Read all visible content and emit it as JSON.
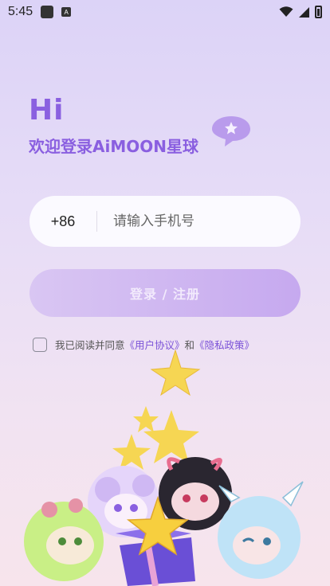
{
  "status_bar": {
    "time": "5:45",
    "a_badge": "A"
  },
  "header": {
    "greeting": "Hi",
    "welcome": "欢迎登录AiMOON星球"
  },
  "phone": {
    "country_code": "+86",
    "placeholder": "请输入手机号",
    "value": ""
  },
  "login": {
    "button_label": "登录 / 注册"
  },
  "agreement": {
    "prefix": "我已阅读并同意",
    "user_agreement": "《用户协议》",
    "and": "和",
    "privacy_policy": "《隐私政策》",
    "checked": false
  },
  "colors": {
    "accent": "#8a60e0",
    "link": "#7b52d8",
    "button_start": "#d9c6f3",
    "button_end": "#c6a9ef"
  },
  "icons": [
    "notification-icon",
    "a-badge-icon",
    "wifi-icon",
    "signal-icon",
    "battery-icon",
    "star-chat-bubble-icon"
  ]
}
